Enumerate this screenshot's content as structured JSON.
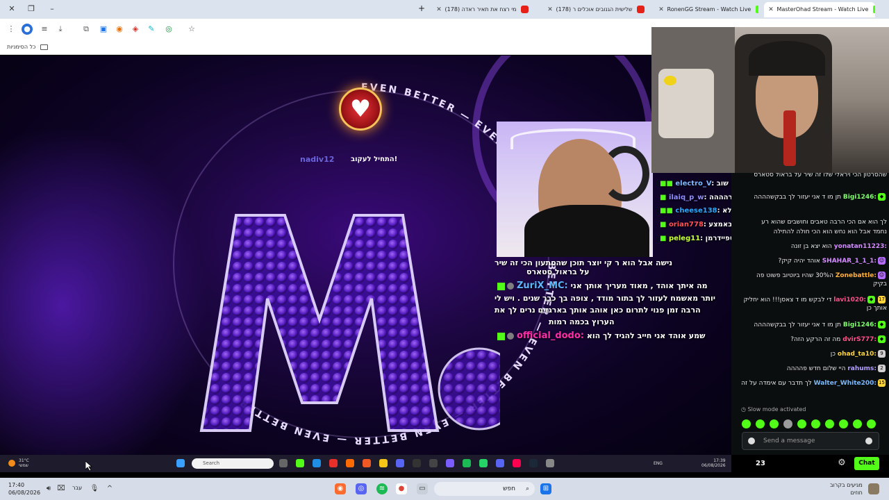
{
  "browser": {
    "tabs": [
      {
        "title": "MasterOhad Stream - Watch Live",
        "favicon": "kick",
        "active": true
      },
      {
        "title": "RonenGG Stream - Watch Live",
        "favicon": "kick",
        "active": false
      },
      {
        "title": "(178) שלישית הגנובים אוכלים ר",
        "favicon": "youtube",
        "active": false
      },
      {
        "title": "(178) מי רצח את תאיר ראדה",
        "favicon": "youtube",
        "active": false
      }
    ],
    "new_tab": "+",
    "bookmarks_label": "כל הסימניות"
  },
  "stream": {
    "ring_text": "EVEN BETTER",
    "overlay_follower_name": "nadiv12",
    "overlay_follow_text": "התחיל לעקוב!",
    "overlay_chat": [
      {
        "text": "נישה אבל הוא ר קי יוצר תוכן שהסתעון הכי זה שיר",
        "color": "#ffffff"
      },
      {
        "text": "על בראול סטארס",
        "color": "#ffffff"
      },
      {
        "user": "ZuriX_MC:",
        "user_color": "#5eb5ff",
        "text": "מה איתך אוהד , מאוד מעריך אותך אני"
      },
      {
        "text": "יותר מאשמח לעזור לך בתור מודד , צופה בך כבר שנים . ויש לי",
        "color": "#ffffff"
      },
      {
        "text": "הרבה זמן פנוי לתרום כאן אוהב אותך בארגזים נרים לך את",
        "color": "#ffffff"
      },
      {
        "text": "הערוץ בכמה רמות",
        "color": "#ffffff"
      },
      {
        "user": "official_dodo:",
        "user_color": "#ff2ea8",
        "text": "שמע אוהד אני חייב להגיד לך הוא"
      }
    ],
    "mini_chat": [
      {
        "user": "electro_V",
        "color": "#7ab8ff",
        "text": ": שוב"
      },
      {
        "user": "ilaiq_p_w",
        "color": "#8f8cff",
        "text": ": מה קרהההה"
      },
      {
        "user": "cheese138",
        "color": "#2aa8ff",
        "text": ": טוב לא"
      },
      {
        "user": "orian778",
        "color": "#ff5454",
        "text": ": עזוב אותה באמצע"
      },
      {
        "user": "peleg11",
        "color": "#c7ff3a",
        "text": ": ראיתה את הסרט החדש של ספיידרמן"
      }
    ]
  },
  "chat": {
    "messages": [
      {
        "user": "",
        "color": "#e8e8e8",
        "text": "שהסרטון הכי ויראלי שלו זה שיר על בראול סטארס"
      },
      {
        "user": "Bigi1246:",
        "color": "#7dff6b",
        "text": "תן מו ד אני יעזור לך בבקשהההה"
      },
      {
        "user": "",
        "color": "#e8e8e8",
        "text": "לך הוא אם הכי הרבה טאבים וחושבים שהוא רע"
      },
      {
        "user": "",
        "color": "#e8e8e8",
        "text": "נחמד אבל הוא נחש הוא הכי חולה להתילה"
      },
      {
        "user": "yonatan11223:",
        "color": "#d38bff",
        "text": "הוא יצא בן זונה"
      },
      {
        "user": "SHAHAR_1_1_1:",
        "color": "#d38bff",
        "text": "אוהד יהיה קיק?"
      },
      {
        "user": "Zonebattle:",
        "color": "#ffb13b",
        "text": "ה30% שהיו ביוטיוב פשוט פה בקיק"
      },
      {
        "user": "lavi1020:",
        "color": "#ff4f8a",
        "text": "די לבקש מו ד צאסן!!! הוא יחליק אותך כן"
      },
      {
        "user": "Bigi1246:",
        "color": "#7dff6b",
        "text": "תן מו ד אני יעזור לך בבקשהההה"
      },
      {
        "user": "dvirS777:",
        "color": "#ff4f8a",
        "text": "מה זה הרקע הזה?"
      },
      {
        "user": "ohad_ta10:",
        "color": "#ffd43b",
        "text": "כן"
      },
      {
        "user": "rahums:",
        "color": "#b4a0ff",
        "text": "היי שלום חדש פהההה"
      },
      {
        "user": "Walter_White200:",
        "color": "#7ab8ff",
        "text": "לך תדבר עם אימדה על זה"
      }
    ],
    "slow_mode": "Slow mode activated",
    "input_placeholder": "Send a message",
    "viewer_count": "23",
    "chat_button": "Chat"
  },
  "inner_taskbar": {
    "search_placeholder": "Search",
    "weather_temp": "31°C",
    "weather_desc": "שמשי",
    "lang": "ENG",
    "time": "17:39",
    "date": "06/08/2026"
  },
  "taskbar": {
    "time": "17:40",
    "date": "06/08/2026",
    "lang": "עבר",
    "search_text": "חפש",
    "news_line1": "מגיעים בקרוב",
    "news_line2": "חוזים"
  },
  "colors": {
    "kick_green": "#53fc18",
    "chat_bg": "#0b0e0f",
    "stream_purple": "#3a0a7a"
  }
}
